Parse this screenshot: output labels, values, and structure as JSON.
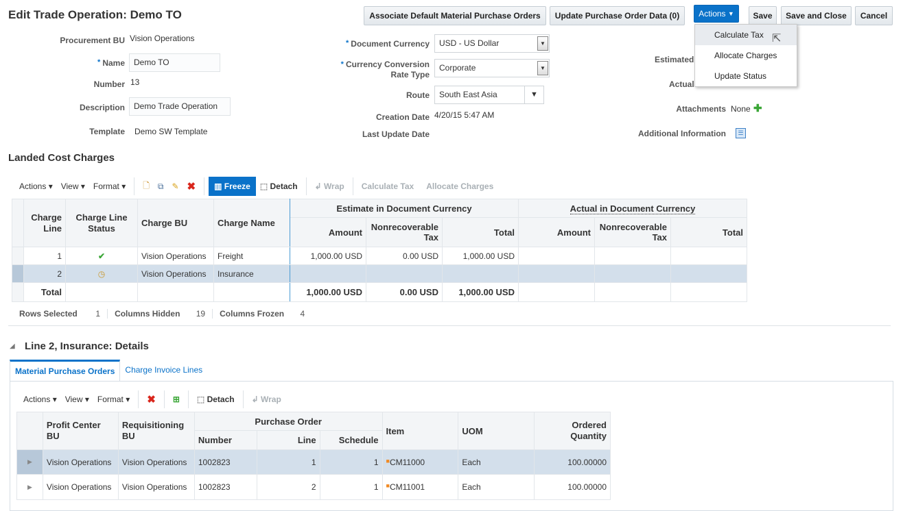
{
  "page": {
    "title": "Edit Trade Operation: Demo TO"
  },
  "header_buttons": {
    "associate": "Associate Default Material Purchase Orders",
    "update_po": "Update Purchase Order Data (0)",
    "actions": "Actions",
    "save": "Save",
    "save_close": "Save and Close",
    "cancel": "Cancel"
  },
  "actions_menu": [
    "Calculate Tax",
    "Allocate Charges",
    "Update Status"
  ],
  "form": {
    "procurement_bu_label": "Procurement BU",
    "procurement_bu": "Vision Operations",
    "name_label": "Name",
    "name": "Demo TO",
    "number_label": "Number",
    "number": "13",
    "description_label": "Description",
    "description": "Demo Trade Operation",
    "template_label": "Template",
    "template": "Demo SW Template",
    "doc_currency_label": "Document Currency",
    "doc_currency": "USD - US Dollar",
    "conv_label1": "Currency Conversion",
    "conv_label2": "Rate Type",
    "conv": "Corporate",
    "route_label": "Route",
    "route": "South East Asia",
    "creation_label": "Creation Date",
    "creation": "4/20/15 5:47 AM",
    "last_update_label": "Last Update Date",
    "estimated_label": "Estimated",
    "actual_label": "Actual",
    "attachments_label": "Attachments",
    "attachments": "None",
    "additional_label": "Additional Information"
  },
  "landed": {
    "title": "Landed Cost Charges",
    "toolbar": {
      "actions": "Actions",
      "view": "View",
      "format": "Format",
      "freeze": "Freeze",
      "detach": "Detach",
      "wrap": "Wrap",
      "calc_tax": "Calculate Tax",
      "allocate": "Allocate Charges"
    },
    "headers": {
      "charge_line": "Charge Line",
      "status": "Charge Line Status",
      "bu": "Charge BU",
      "name": "Charge Name",
      "estimate": "Estimate in Document Currency",
      "actual": "Actual in Document Currency",
      "amount": "Amount",
      "nonrec": "Nonrecoverable Tax",
      "total": "Total"
    },
    "rows": [
      {
        "line": "1",
        "status": "complete",
        "bu": "Vision Operations",
        "name": "Freight",
        "amount": "1,000.00 USD",
        "nonrec": "0.00 USD",
        "total": "1,000.00 USD"
      },
      {
        "line": "2",
        "status": "pending",
        "bu": "Vision Operations",
        "name": "Insurance",
        "amount": "",
        "nonrec": "",
        "total": ""
      }
    ],
    "totals": {
      "label": "Total",
      "amount": "1,000.00 USD",
      "nonrec": "0.00 USD",
      "total": "1,000.00 USD"
    },
    "footer": {
      "rows_selected_label": "Rows Selected",
      "rows_selected": "1",
      "cols_hidden_label": "Columns Hidden",
      "cols_hidden": "19",
      "cols_frozen_label": "Columns Frozen",
      "cols_frozen": "4"
    }
  },
  "details": {
    "title": "Line 2, Insurance: Details",
    "tabs": [
      "Material Purchase Orders",
      "Charge Invoice Lines"
    ],
    "toolbar": {
      "actions": "Actions",
      "view": "View",
      "format": "Format",
      "detach": "Detach",
      "wrap": "Wrap"
    },
    "headers": {
      "pc_bu": "Profit Center BU",
      "req_bu": "Requisitioning BU",
      "po": "Purchase Order",
      "number": "Number",
      "line": "Line",
      "schedule": "Schedule",
      "item": "Item",
      "uom": "UOM",
      "qty": "Ordered Quantity"
    },
    "rows": [
      {
        "pc_bu": "Vision Operations",
        "req_bu": "Vision Operations",
        "number": "1002823",
        "line": "1",
        "schedule": "1",
        "item": "CM11000",
        "uom": "Each",
        "qty": "100.00000"
      },
      {
        "pc_bu": "Vision Operations",
        "req_bu": "Vision Operations",
        "number": "1002823",
        "line": "2",
        "schedule": "1",
        "item": "CM11001",
        "uom": "Each",
        "qty": "100.00000"
      }
    ]
  }
}
